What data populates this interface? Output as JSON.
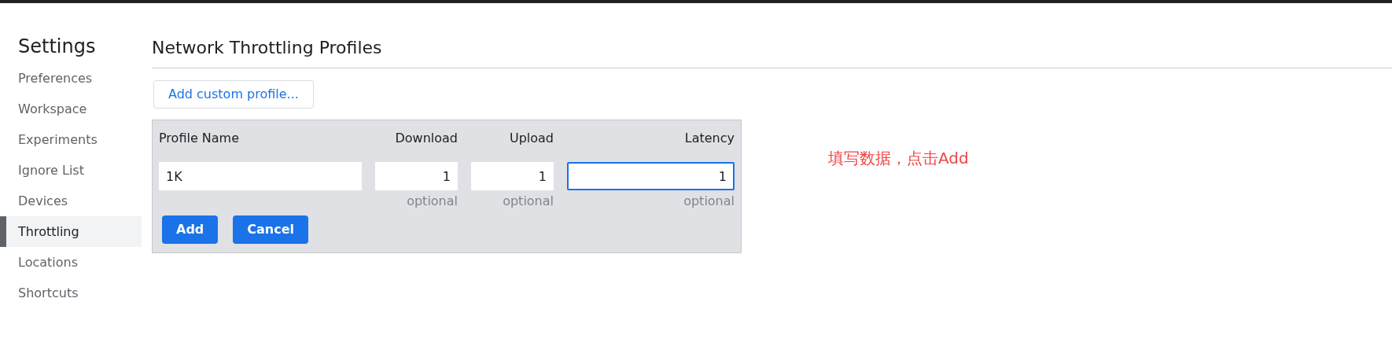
{
  "sidebar": {
    "title": "Settings",
    "items": [
      {
        "label": "Preferences",
        "selected": false
      },
      {
        "label": "Workspace",
        "selected": false
      },
      {
        "label": "Experiments",
        "selected": false
      },
      {
        "label": "Ignore List",
        "selected": false
      },
      {
        "label": "Devices",
        "selected": false
      },
      {
        "label": "Throttling",
        "selected": true
      },
      {
        "label": "Locations",
        "selected": false
      },
      {
        "label": "Shortcuts",
        "selected": false
      }
    ]
  },
  "main": {
    "title": "Network Throttling Profiles",
    "add_button": "Add custom profile...",
    "form": {
      "fields": [
        {
          "label": "Profile Name",
          "value": "1K",
          "focused": false
        },
        {
          "label": "Download",
          "value": "1",
          "hint": "optional",
          "focused": false
        },
        {
          "label": "Upload",
          "value": "1",
          "hint": "optional",
          "focused": false
        },
        {
          "label": "Latency",
          "value": "1",
          "hint": "optional",
          "focused": true
        }
      ],
      "buttons": [
        "Add",
        "Cancel"
      ]
    }
  },
  "annotation": "填写数据，点击Add"
}
